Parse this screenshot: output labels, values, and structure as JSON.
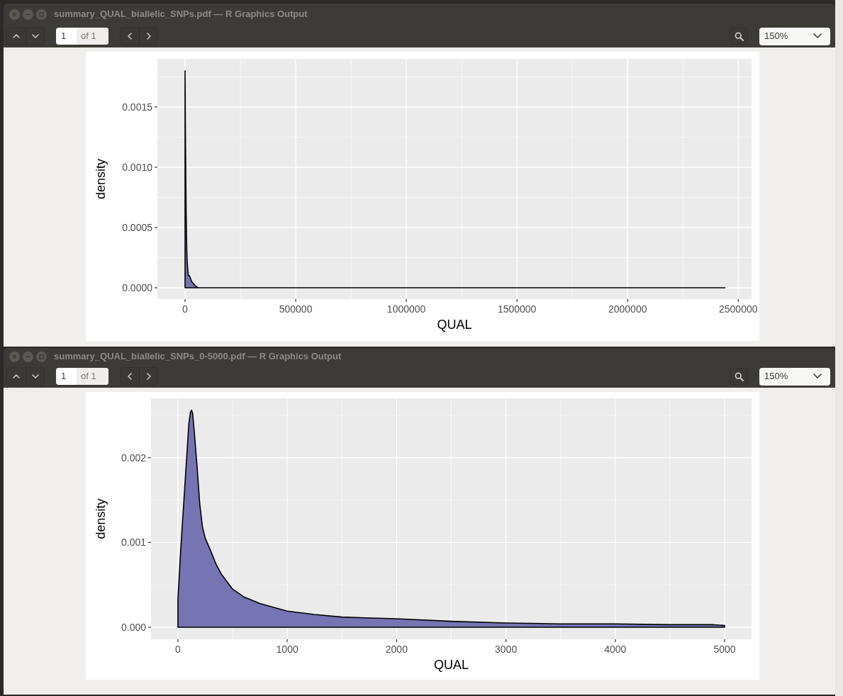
{
  "windows": [
    {
      "title": "summary_QUAL_biallelic_SNPs.pdf — R Graphics Output",
      "page_field": {
        "value": "1",
        "total": "of 1"
      },
      "zoom": "150%",
      "chart_data": {
        "type": "area",
        "xlabel": "QUAL",
        "ylabel": "density",
        "grid": true,
        "x": [
          0,
          2000,
          5000,
          8000,
          10000,
          15000,
          20000,
          30000,
          40000,
          50000,
          60000,
          100000,
          500000,
          1000000,
          1500000,
          2000000,
          2440000
        ],
        "series": [
          {
            "color": "#7674b3",
            "values": [
              0.0018,
              0.0012,
              0.0006,
              0.0003,
              0.0002,
              0.0001,
              0.0001,
              5e-05,
              3e-05,
              1e-05,
              0,
              0,
              0,
              0,
              0,
              0,
              0
            ]
          }
        ],
        "xlim": [
          -125000,
          2560000
        ],
        "ylim": [
          -9.4e-05,
          0.0019
        ],
        "xticks": [
          0,
          500000,
          1000000,
          1500000,
          2000000,
          2500000
        ],
        "yticks": [
          {
            "value": 0,
            "label": "0.0000"
          },
          {
            "value": 0.0005,
            "label": "0.0005"
          },
          {
            "value": 0.001,
            "label": "0.0010"
          },
          {
            "value": 0.0015,
            "label": "0.0015"
          }
        ]
      }
    },
    {
      "title": "summary_QUAL_biallelic_SNPs_0-5000.pdf — R Graphics Output",
      "page_field": {
        "value": "1",
        "total": "of 1"
      },
      "zoom": "150%",
      "chart_data": {
        "type": "area",
        "xlabel": "QUAL",
        "ylabel": "density",
        "grid": true,
        "x": [
          0,
          25,
          50,
          75,
          100,
          115,
          125,
          135,
          150,
          175,
          200,
          225,
          250,
          300,
          350,
          400,
          500,
          600,
          750,
          1000,
          1250,
          1500,
          2000,
          2500,
          3000,
          3500,
          4000,
          4500,
          4900,
          5000
        ],
        "series": [
          {
            "color": "#7674b3",
            "values": [
              0.00033,
              0.0009,
              0.0014,
              0.0019,
              0.0024,
              0.00254,
              0.00256,
              0.00252,
              0.0023,
              0.0019,
              0.00145,
              0.00118,
              0.00105,
              0.0009,
              0.00074,
              0.00062,
              0.00045,
              0.00036,
              0.00028,
              0.00019,
              0.00015,
              0.00012,
              0.0001,
              7e-05,
              5e-05,
              4e-05,
              4e-05,
              3e-05,
              3e-05,
              2e-05
            ]
          }
        ],
        "xlim": [
          -246,
          5246
        ],
        "ylim": [
          -0.000142,
          0.0027
        ],
        "xticks": [
          0,
          1000,
          2000,
          3000,
          4000,
          5000
        ],
        "yticks": [
          {
            "value": 0,
            "label": "0.000"
          },
          {
            "value": 0.001,
            "label": "0.001"
          },
          {
            "value": 0.002,
            "label": "0.002"
          }
        ]
      }
    }
  ]
}
